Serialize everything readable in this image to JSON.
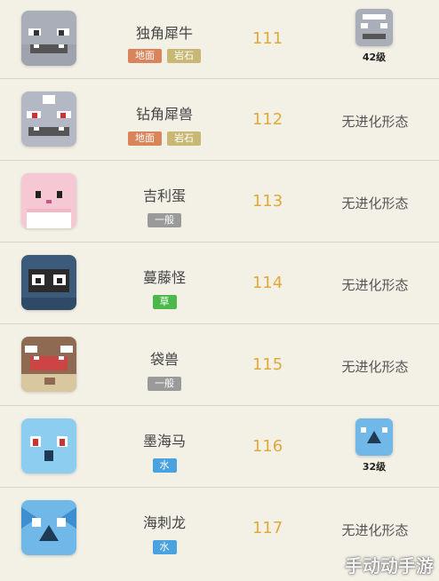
{
  "colors": {
    "num": "#e1a93a",
    "ground": "#d9845a",
    "rock": "#c9b875",
    "normal": "#9a9a9a",
    "grass": "#4cb84c",
    "water": "#4aa3e0"
  },
  "rows": [
    {
      "name": "独角犀牛",
      "types": [
        {
          "label": "地面",
          "kind": "ground"
        },
        {
          "label": "岩石",
          "kind": "rock"
        }
      ],
      "number": "111",
      "evolution": {
        "kind": "icon",
        "level": "42级"
      }
    },
    {
      "name": "钻角犀兽",
      "types": [
        {
          "label": "地面",
          "kind": "ground"
        },
        {
          "label": "岩石",
          "kind": "rock"
        }
      ],
      "number": "112",
      "evolution": {
        "kind": "text",
        "text": "无进化形态"
      }
    },
    {
      "name": "吉利蛋",
      "types": [
        {
          "label": "一般",
          "kind": "normal"
        }
      ],
      "number": "113",
      "evolution": {
        "kind": "text",
        "text": "无进化形态"
      }
    },
    {
      "name": "蔓藤怪",
      "types": [
        {
          "label": "草",
          "kind": "grass"
        }
      ],
      "number": "114",
      "evolution": {
        "kind": "text",
        "text": "无进化形态"
      }
    },
    {
      "name": "袋兽",
      "types": [
        {
          "label": "一般",
          "kind": "normal"
        }
      ],
      "number": "115",
      "evolution": {
        "kind": "text",
        "text": "无进化形态"
      }
    },
    {
      "name": "墨海马",
      "types": [
        {
          "label": "水",
          "kind": "water"
        }
      ],
      "number": "116",
      "evolution": {
        "kind": "icon",
        "level": "32级"
      }
    },
    {
      "name": "海刺龙",
      "types": [
        {
          "label": "水",
          "kind": "water"
        }
      ],
      "number": "117",
      "evolution": {
        "kind": "text",
        "text": "无进化形态"
      }
    }
  ],
  "watermark": "手动动手游"
}
